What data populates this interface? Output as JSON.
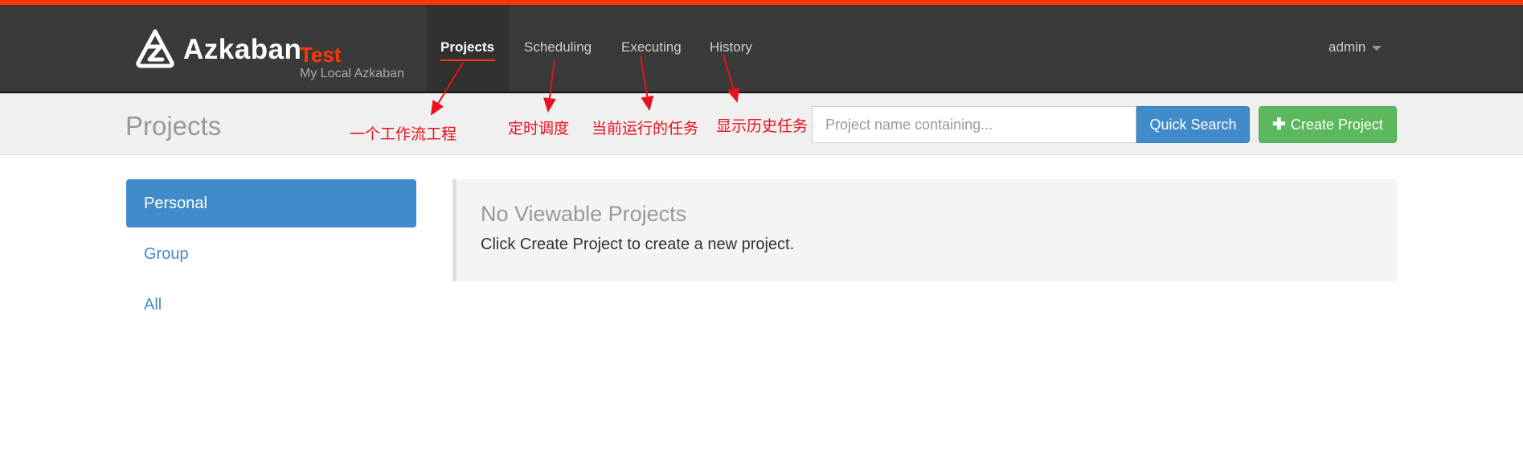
{
  "brand": {
    "name": "Azkaban",
    "environment": "Test",
    "subtitle": "My Local Azkaban",
    "logo_icon": "azkaban-logo-icon"
  },
  "nav": {
    "items": [
      {
        "label": "Projects",
        "active": true
      },
      {
        "label": "Scheduling",
        "active": false
      },
      {
        "label": "Executing",
        "active": false
      },
      {
        "label": "History",
        "active": false
      }
    ],
    "user": {
      "label": "admin",
      "icon": "caret-down-icon"
    }
  },
  "header": {
    "title": "Projects",
    "search": {
      "placeholder": "Project name containing...",
      "value": ""
    },
    "quick_search_label": "Quick Search",
    "create_project_label": "Create Project",
    "create_icon": "plus-icon"
  },
  "sidebar": {
    "items": [
      {
        "label": "Personal",
        "active": true
      },
      {
        "label": "Group",
        "active": false
      },
      {
        "label": "All",
        "active": false
      }
    ]
  },
  "panel": {
    "title": "No Viewable Projects",
    "text": "Click Create Project to create a new project."
  },
  "annotations": {
    "projects": "一个工作流工程",
    "scheduling": "定时调度",
    "executing": "当前运行的任务",
    "history": "显示历史任务"
  },
  "colors": {
    "accent_orange": "#ff3601",
    "navbar_bg": "#3a3a3a",
    "primary_blue": "#428bca",
    "success_green": "#5cb85c",
    "annotation_red": "#e8121b"
  }
}
